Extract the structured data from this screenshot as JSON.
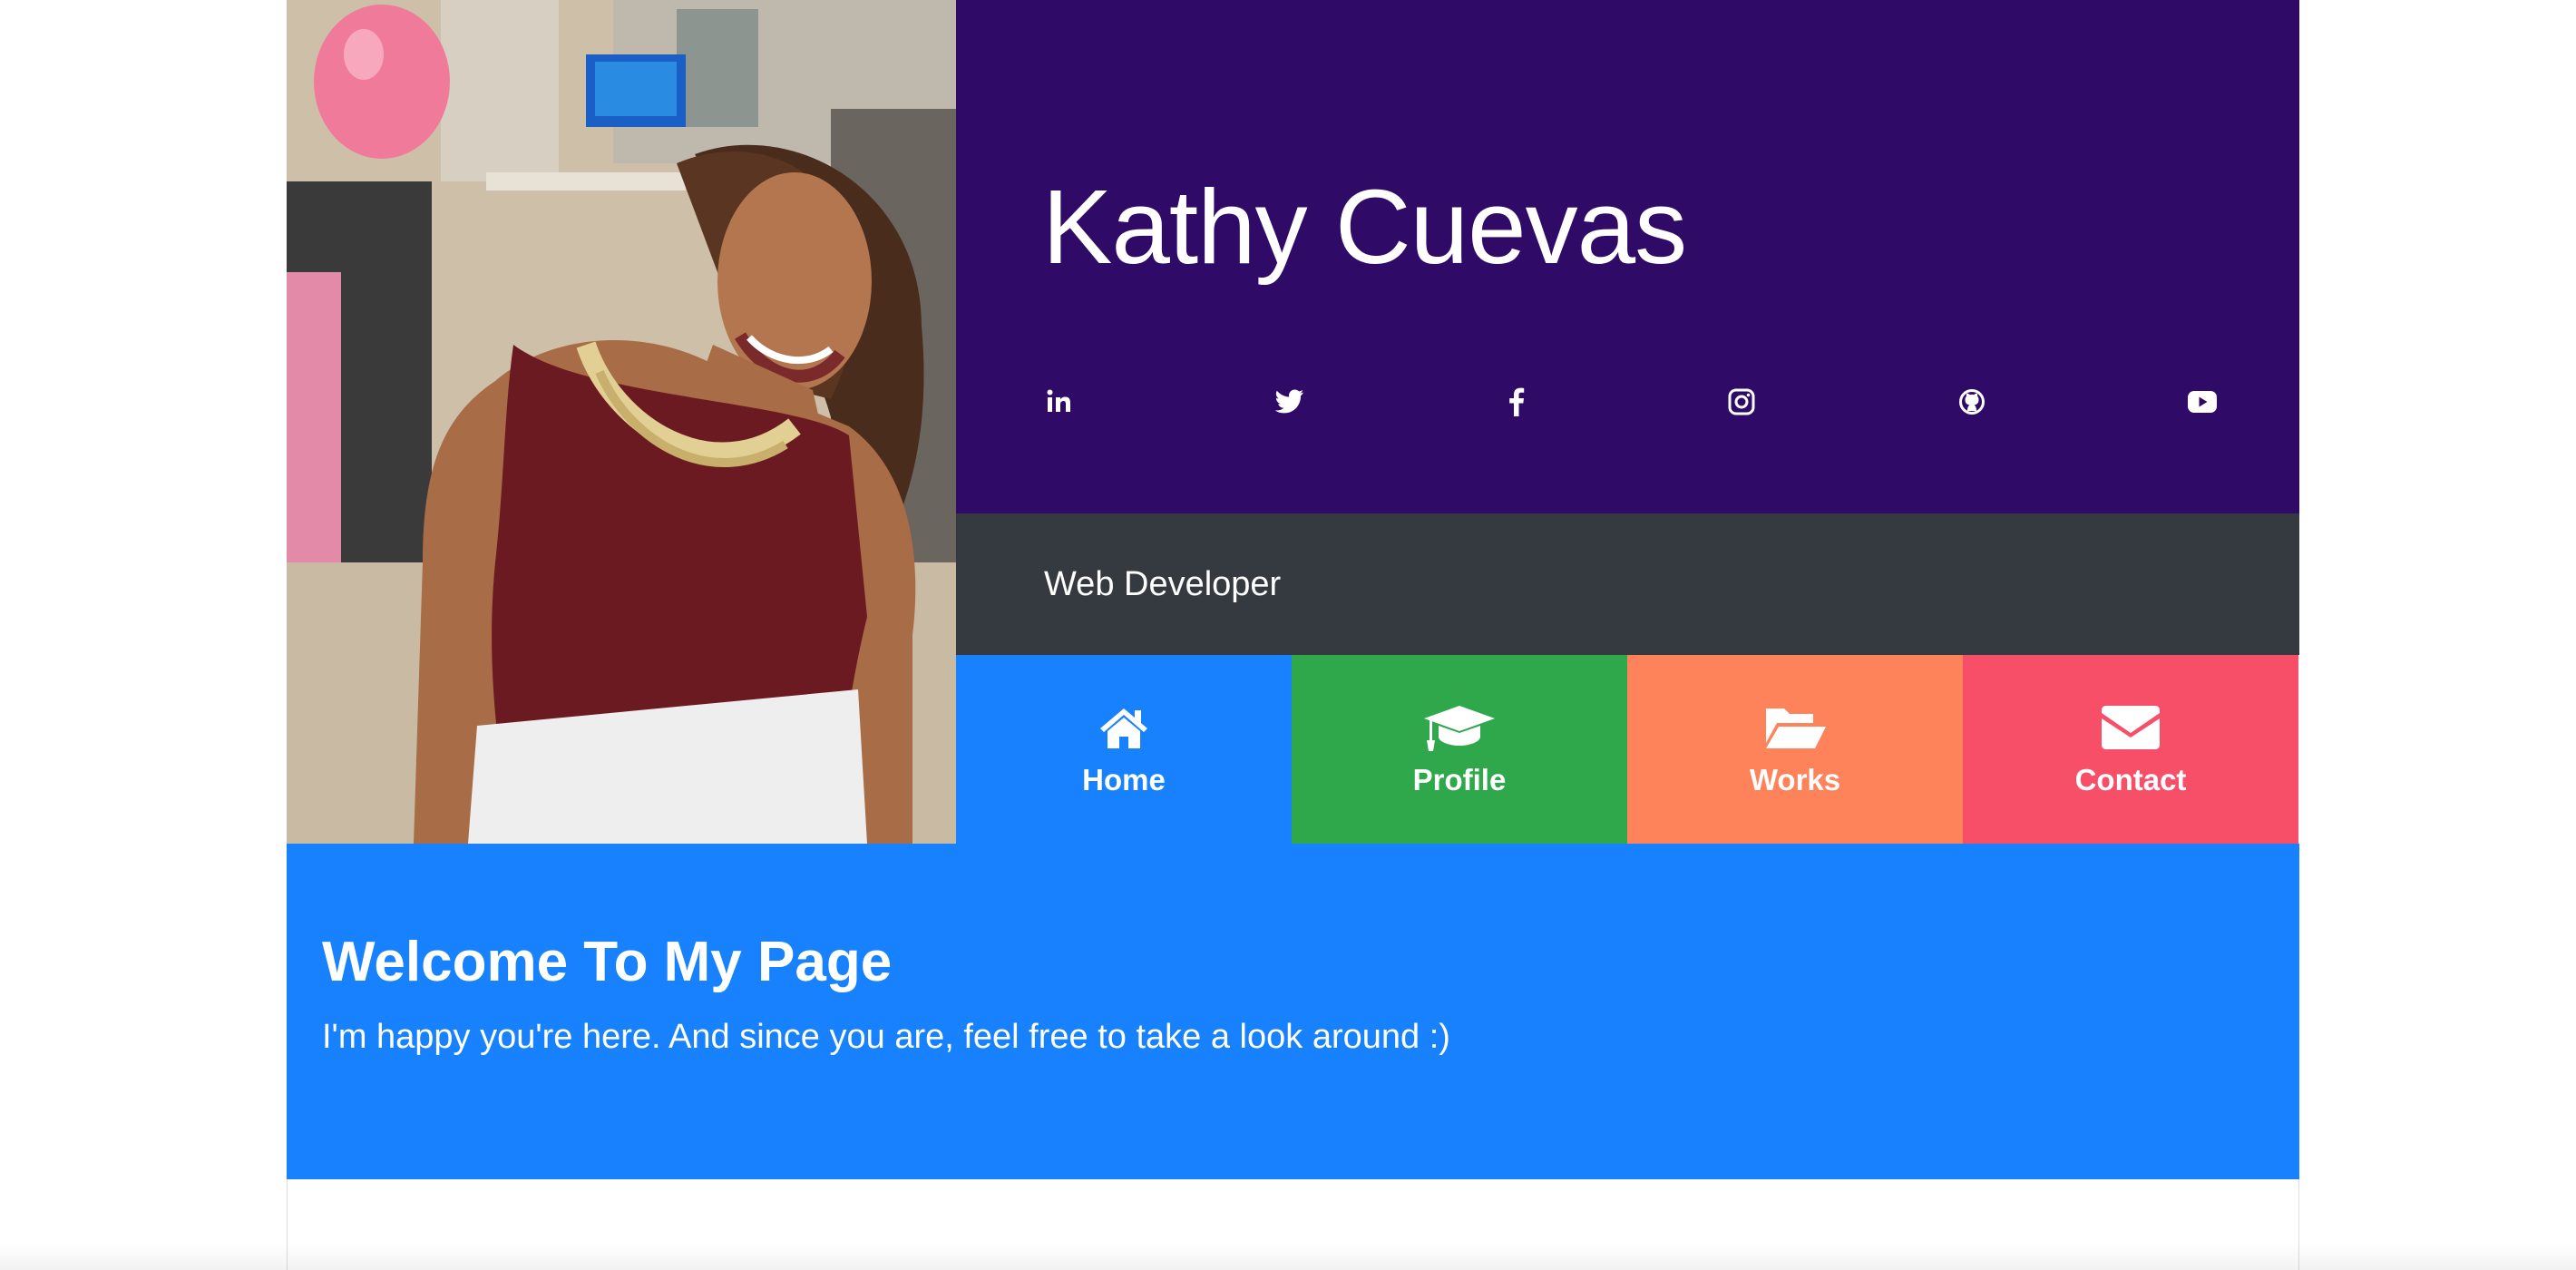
{
  "profile": {
    "name": "Kathy Cuevas",
    "role": "Web Developer",
    "photo_alt": "Kathy Cuevas portrait"
  },
  "social": [
    {
      "name": "linkedin",
      "icon": "linkedin-icon"
    },
    {
      "name": "twitter",
      "icon": "twitter-icon"
    },
    {
      "name": "facebook",
      "icon": "facebook-icon"
    },
    {
      "name": "instagram",
      "icon": "instagram-icon"
    },
    {
      "name": "github",
      "icon": "github-icon"
    },
    {
      "name": "youtube",
      "icon": "youtube-icon"
    }
  ],
  "nav": [
    {
      "label": "Home",
      "icon": "home-icon",
      "color": "#1781fe"
    },
    {
      "label": "Profile",
      "icon": "graduation-cap-icon",
      "color": "#2ea84a"
    },
    {
      "label": "Works",
      "icon": "folder-open-icon",
      "color": "#fe835a"
    },
    {
      "label": "Contact",
      "icon": "envelope-icon",
      "color": "#f84f69"
    }
  ],
  "welcome": {
    "title": "Welcome To My Page",
    "text": "I'm happy you're here. And since you are, feel free to take a look around :)"
  },
  "colors": {
    "header_bg": "#2f0a67",
    "subbar_bg": "#343a40",
    "welcome_bg": "#1781fe"
  }
}
